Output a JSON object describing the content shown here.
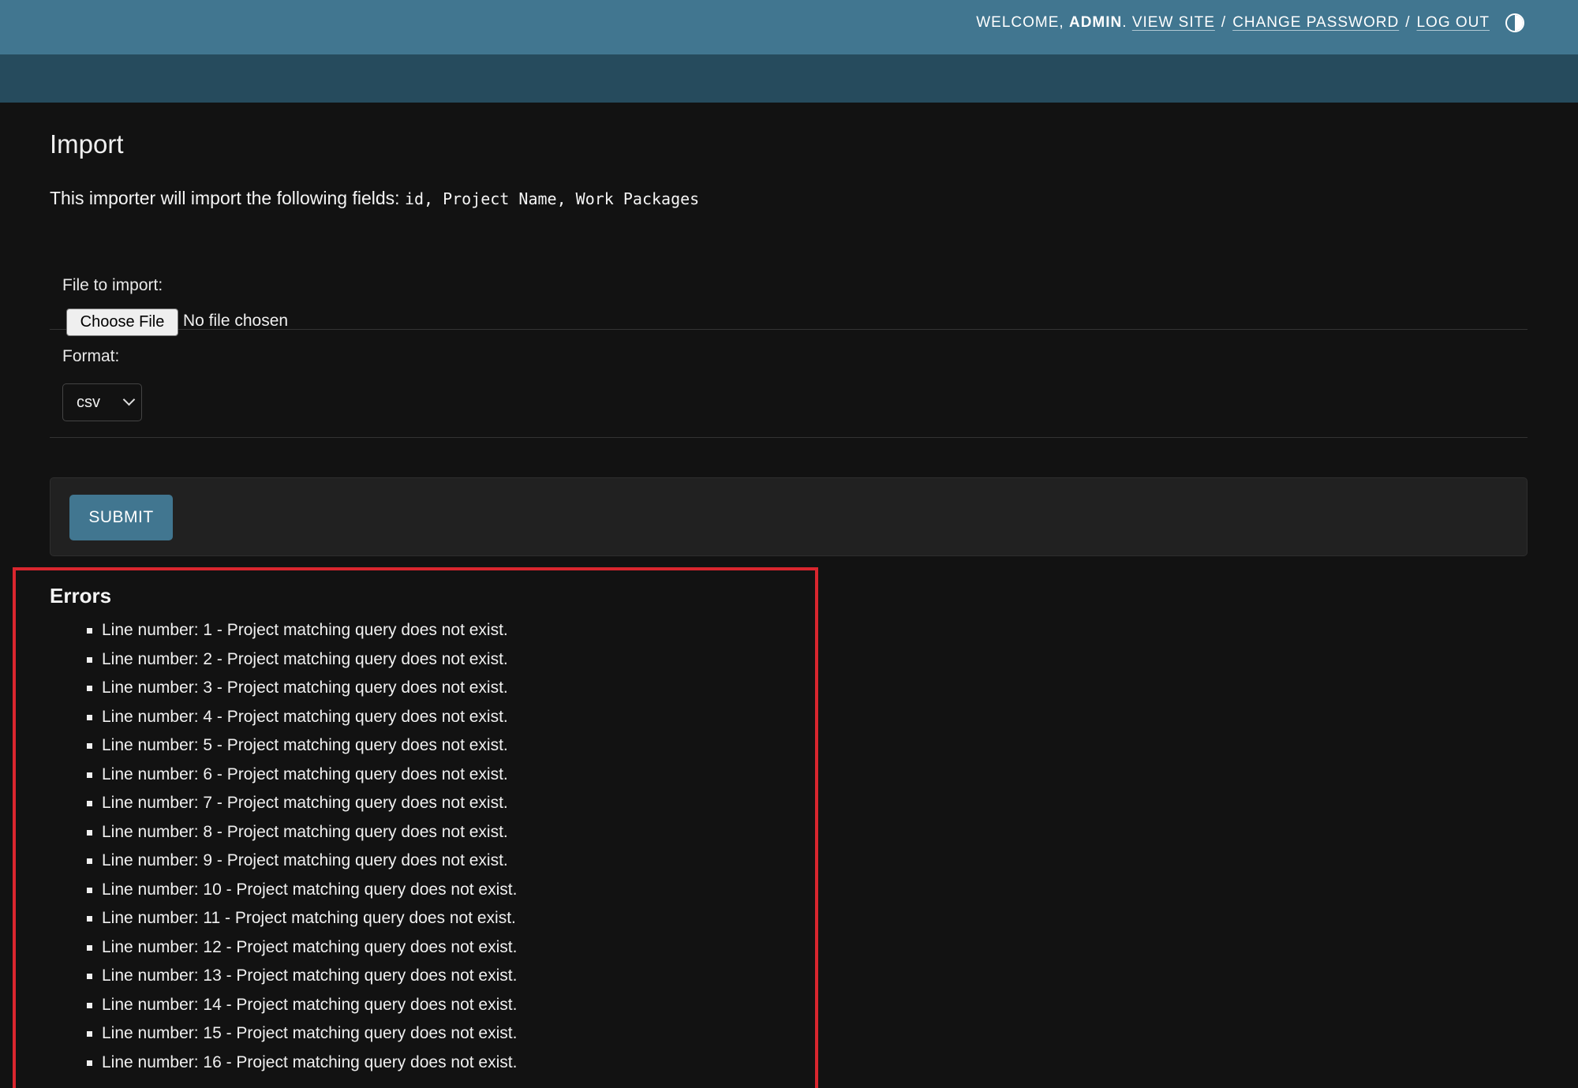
{
  "header": {
    "welcome": "Welcome,",
    "username": "admin",
    "view_site": "View site",
    "change_password": "Change password",
    "log_out": "Log out",
    "separator": "/",
    "theme_icon": "contrast-toggle-icon"
  },
  "page": {
    "title": "Import",
    "intro_text": "This importer will import the following fields:",
    "fields": "id, Project Name, Work Packages"
  },
  "form": {
    "file_label": "File to import:",
    "file_button": "Choose File",
    "file_status": "No file chosen",
    "format_label": "Format:",
    "format_value": "csv",
    "submit_label": "SUBMIT"
  },
  "errors": {
    "title": "Errors",
    "items": [
      "Line number: 1 - Project matching query does not exist.",
      "Line number: 2 - Project matching query does not exist.",
      "Line number: 3 - Project matching query does not exist.",
      "Line number: 4 - Project matching query does not exist.",
      "Line number: 5 - Project matching query does not exist.",
      "Line number: 6 - Project matching query does not exist.",
      "Line number: 7 - Project matching query does not exist.",
      "Line number: 8 - Project matching query does not exist.",
      "Line number: 9 - Project matching query does not exist.",
      "Line number: 10 - Project matching query does not exist.",
      "Line number: 11 - Project matching query does not exist.",
      "Line number: 12 - Project matching query does not exist.",
      "Line number: 13 - Project matching query does not exist.",
      "Line number: 14 - Project matching query does not exist.",
      "Line number: 15 - Project matching query does not exist.",
      "Line number: 16 - Project matching query does not exist."
    ]
  },
  "colors": {
    "header": "#417690",
    "breadcrumb_bar": "#264b5d",
    "background": "#121212",
    "error_border": "#d9262e"
  }
}
